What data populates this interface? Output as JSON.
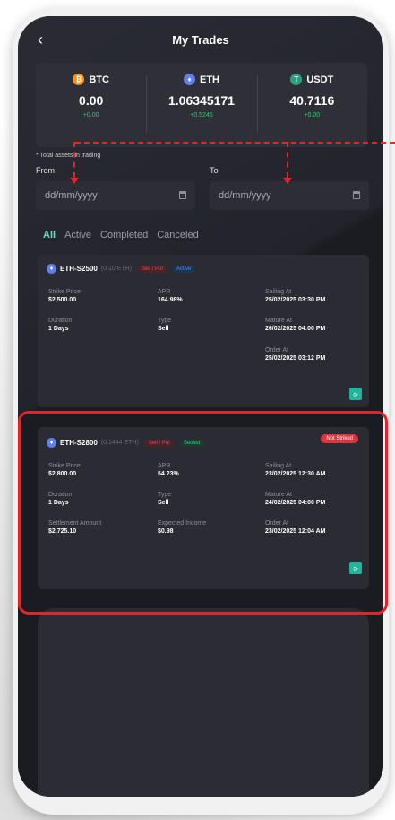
{
  "header": {
    "back_icon": "chevron-left-icon",
    "title": "My Trades"
  },
  "assets": [
    {
      "symbol": "BTC",
      "amount": "0.00",
      "change": "+0.00",
      "color": "#f7931a",
      "icon": "bitcoin-icon",
      "glyph": "₿"
    },
    {
      "symbol": "ETH",
      "amount": "1.06345171",
      "change": "+0.5245",
      "color": "#627eea",
      "icon": "ethereum-icon",
      "glyph": "♦"
    },
    {
      "symbol": "USDT",
      "amount": "40.7116",
      "change": "+0.00",
      "color": "#26a17b",
      "icon": "tether-icon",
      "glyph": "T"
    }
  ],
  "total_note": "* Total assets in trading",
  "filters": {
    "from_label": "From",
    "to_label": "To",
    "from_placeholder": "dd/mm/yyyy",
    "to_placeholder": "dd/mm/yyyy"
  },
  "tabs": [
    {
      "label": "All",
      "active": true
    },
    {
      "label": "Active",
      "active": false
    },
    {
      "label": "Completed",
      "active": false
    },
    {
      "label": "Canceled",
      "active": false
    }
  ],
  "trades": [
    {
      "pair": "ETH-S2500",
      "quantity": "(0.10 ETH)",
      "side_badge": "Sell / Put",
      "status_badge": "Active",
      "strike_label": "Strike Price",
      "strike": "$2,500.00",
      "apr_label": "APR",
      "apr": "164.98%",
      "sailing_label": "Sailing At",
      "sailing": "25/02/2025 03:30 PM",
      "duration_label": "Duration",
      "duration": "1 Days",
      "type_label": "Type",
      "type": "Sell",
      "mature_label": "Mature At",
      "mature": "26/02/2025 04:00 PM",
      "order_label": "Order At",
      "order": "25/02/2025 03:12 PM"
    },
    {
      "pair": "ETH-S2800",
      "quantity": "(0.1444 ETH)",
      "side_badge": "Sell / Put",
      "status_badge": "Settled",
      "result_badge": "Not Striked",
      "strike_label": "Strike Price",
      "strike": "$2,800.00",
      "apr_label": "APR",
      "apr": "54.23%",
      "sailing_label": "Sailing At",
      "sailing": "23/02/2025 12:30 AM",
      "duration_label": "Duration",
      "duration": "1 Days",
      "type_label": "Type",
      "type": "Sell",
      "mature_label": "Mature At",
      "mature": "24/02/2025 04:00 PM",
      "settlement_label": "Settlement Amount",
      "settlement": "$2,725.10",
      "income_label": "Expected Income",
      "income": "$0.98",
      "order_label": "Order At",
      "order": "23/02/2025 12:04 AM"
    }
  ],
  "colors": {
    "accent": "#5de2c8",
    "highlight": "#e5232b",
    "positive": "#2ecc71",
    "negative": "#e5484d"
  }
}
